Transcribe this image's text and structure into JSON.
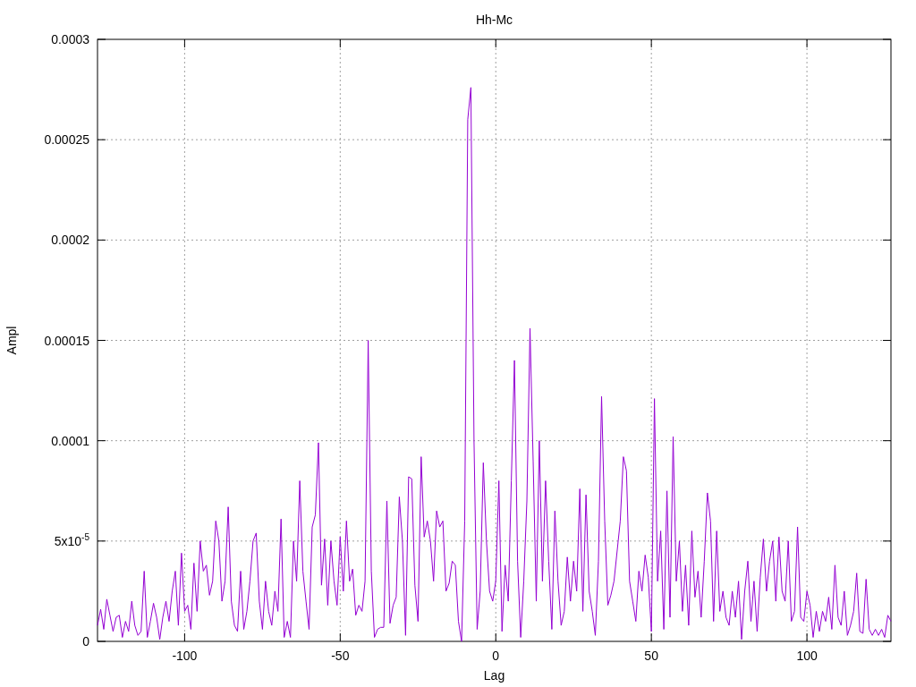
{
  "plot": {
    "chart_data": {
      "type": "line",
      "title": "Hh-Mc",
      "xlabel": "Lag",
      "ylabel": "Ampl",
      "xlim": [
        -128,
        127
      ],
      "ylim": [
        0,
        0.0003
      ],
      "grid": true,
      "x": [
        -128,
        -127,
        -126,
        -125,
        -124,
        -123,
        -122,
        -121,
        -120,
        -119,
        -118,
        -117,
        -116,
        -115,
        -114,
        -113,
        -112,
        -111,
        -110,
        -109,
        -108,
        -107,
        -106,
        -105,
        -104,
        -103,
        -102,
        -101,
        -100,
        -99,
        -98,
        -97,
        -96,
        -95,
        -94,
        -93,
        -92,
        -91,
        -90,
        -89,
        -88,
        -87,
        -86,
        -85,
        -84,
        -83,
        -82,
        -81,
        -80,
        -79,
        -78,
        -77,
        -76,
        -75,
        -74,
        -73,
        -72,
        -71,
        -70,
        -69,
        -68,
        -67,
        -66,
        -65,
        -64,
        -63,
        -62,
        -61,
        -60,
        -59,
        -58,
        -57,
        -56,
        -55,
        -54,
        -53,
        -52,
        -51,
        -50,
        -49,
        -48,
        -47,
        -46,
        -45,
        -44,
        -43,
        -42,
        -41,
        -40,
        -39,
        -38,
        -37,
        -36,
        -35,
        -34,
        -33,
        -32,
        -31,
        -30,
        -29,
        -28,
        -27,
        -26,
        -25,
        -24,
        -23,
        -22,
        -21,
        -20,
        -19,
        -18,
        -17,
        -16,
        -15,
        -14,
        -13,
        -12,
        -11,
        -10,
        -9,
        -8,
        -7,
        -6,
        -5,
        -4,
        -3,
        -2,
        -1,
        0,
        1,
        2,
        3,
        4,
        5,
        6,
        7,
        8,
        9,
        10,
        11,
        12,
        13,
        14,
        15,
        16,
        17,
        18,
        19,
        20,
        21,
        22,
        23,
        24,
        25,
        26,
        27,
        28,
        29,
        30,
        31,
        32,
        33,
        34,
        35,
        36,
        37,
        38,
        39,
        40,
        41,
        42,
        43,
        44,
        45,
        46,
        47,
        48,
        49,
        50,
        51,
        52,
        53,
        54,
        55,
        56,
        57,
        58,
        59,
        60,
        61,
        62,
        63,
        64,
        65,
        66,
        67,
        68,
        69,
        70,
        71,
        72,
        73,
        74,
        75,
        76,
        77,
        78,
        79,
        80,
        81,
        82,
        83,
        84,
        85,
        86,
        87,
        88,
        89,
        90,
        91,
        92,
        93,
        94,
        95,
        96,
        97,
        98,
        99,
        100,
        101,
        102,
        103,
        104,
        105,
        106,
        107,
        108,
        109,
        110,
        111,
        112,
        113,
        114,
        115,
        116,
        117,
        118,
        119,
        120,
        121,
        122,
        123,
        124,
        125,
        126,
        127
      ],
      "xticks": [
        {
          "value": -100,
          "label": "-100"
        },
        {
          "value": -50,
          "label": "-50"
        },
        {
          "value": 0,
          "label": "0"
        },
        {
          "value": 50,
          "label": "50"
        },
        {
          "value": 100,
          "label": "100"
        }
      ],
      "yticks": [
        {
          "value": 0,
          "label": "0"
        },
        {
          "value": 5e-05,
          "label": "5x10$^{-5}$"
        },
        {
          "value": 0.0001,
          "label": "0.0001"
        },
        {
          "value": 0.00015,
          "label": "0.00015"
        },
        {
          "value": 0.0002,
          "label": "0.0002"
        },
        {
          "value": 0.00025,
          "label": "0.00025"
        },
        {
          "value": 0.0003,
          "label": "0.0003"
        }
      ],
      "series": [
        {
          "color": "#9400d3",
          "values": [
            8e-06,
            1.6e-05,
            6e-06,
            2.1e-05,
            1.3e-05,
            5e-06,
            1.2e-05,
            1.3e-05,
            2e-06,
            1e-05,
            5e-06,
            2e-05,
            8e-06,
            3e-06,
            5e-06,
            3.5e-05,
            2e-06,
            1e-05,
            1.9e-05,
            1.2e-05,
            1e-06,
            1.2e-05,
            2e-05,
            1e-05,
            2.5e-05,
            3.5e-05,
            8e-06,
            4.4e-05,
            1.5e-05,
            1.8e-05,
            6e-06,
            3.9e-05,
            1.5e-05,
            5e-05,
            3.5e-05,
            3.8e-05,
            2.3e-05,
            3e-05,
            6e-05,
            5e-05,
            2e-05,
            3e-05,
            6.7e-05,
            2e-05,
            8e-06,
            5e-06,
            3.5e-05,
            6e-06,
            1.5e-05,
            3e-05,
            5e-05,
            5.4e-05,
            2e-05,
            6e-06,
            3e-05,
            1.5e-05,
            8e-06,
            2.5e-05,
            1.5e-05,
            6.1e-05,
            2e-06,
            1e-05,
            2e-06,
            5e-05,
            3e-05,
            8e-05,
            3.5e-05,
            2e-05,
            6e-06,
            5.7e-05,
            6.3e-05,
            9.9e-05,
            2.8e-05,
            5.1e-05,
            1.8e-05,
            5e-05,
            3e-05,
            1.8e-05,
            5.2e-05,
            2.5e-05,
            6e-05,
            3e-05,
            3.6e-05,
            1.3e-05,
            1.8e-05,
            1.5e-05,
            3e-05,
            0.00015,
            3.5e-05,
            2e-06,
            6e-06,
            7e-06,
            7e-06,
            7e-05,
            9e-06,
            1.8e-05,
            2.2e-05,
            7.2e-05,
            5e-05,
            3e-06,
            8.2e-05,
            8.1e-05,
            2.8e-05,
            1e-05,
            9.2e-05,
            5.2e-05,
            6e-05,
            5e-05,
            3e-05,
            6.5e-05,
            5.7e-05,
            6e-05,
            2.5e-05,
            2.9e-05,
            4e-05,
            3.8e-05,
            1e-05,
            0.0,
            6e-05,
            0.00026,
            0.000276,
            0.0001,
            6e-06,
            2.5e-05,
            8.9e-05,
            5e-05,
            2.5e-05,
            2e-05,
            3e-05,
            8e-05,
            5e-06,
            3.8e-05,
            2e-05,
            8e-05,
            0.00014,
            4e-05,
            2e-06,
            3e-05,
            7e-05,
            0.000156,
            9e-05,
            2e-05,
            0.0001,
            3e-05,
            8e-05,
            4e-05,
            6e-06,
            6.5e-05,
            3e-05,
            8e-06,
            1.5e-05,
            4.2e-05,
            2e-05,
            4e-05,
            2.5e-05,
            7.6e-05,
            1.5e-05,
            7.3e-05,
            2.5e-05,
            1.5e-05,
            3e-06,
            4e-05,
            0.000122,
            6e-05,
            1.8e-05,
            2.3e-05,
            3e-05,
            4.5e-05,
            6e-05,
            9.2e-05,
            8.5e-05,
            3e-05,
            2e-05,
            1e-05,
            3.5e-05,
            2.5e-05,
            4.3e-05,
            3.2e-05,
            5e-06,
            0.000121,
            3e-05,
            5.5e-05,
            6e-06,
            7.5e-05,
            1.2e-05,
            0.000102,
            3e-05,
            5e-05,
            1.5e-05,
            3.8e-05,
            8e-06,
            5.5e-05,
            2.2e-05,
            3.5e-05,
            1.2e-05,
            4e-05,
            7.4e-05,
            6e-05,
            1e-05,
            5.5e-05,
            1.5e-05,
            2.5e-05,
            1.2e-05,
            8e-06,
            2.5e-05,
            1.2e-05,
            3e-05,
            1e-06,
            2.5e-05,
            4e-05,
            1e-05,
            3e-05,
            5e-06,
            3.2e-05,
            5.1e-05,
            2.5e-05,
            4e-05,
            5e-05,
            2e-05,
            5.2e-05,
            2.5e-05,
            2e-05,
            5e-05,
            1e-05,
            1.5e-05,
            5.7e-05,
            1.2e-05,
            1e-05,
            2.5e-05,
            1.8e-05,
            2e-06,
            1.5e-05,
            5e-06,
            1.5e-05,
            1e-05,
            2.2e-05,
            6e-06,
            3.8e-05,
            1.2e-05,
            8e-06,
            2.5e-05,
            3e-06,
            8e-06,
            1.5e-05,
            3.4e-05,
            5e-06,
            4e-06,
            3.1e-05,
            6e-06,
            3e-06,
            6e-06,
            3e-06,
            6e-06,
            2e-06,
            1.3e-05,
            1e-05
          ]
        }
      ]
    }
  }
}
